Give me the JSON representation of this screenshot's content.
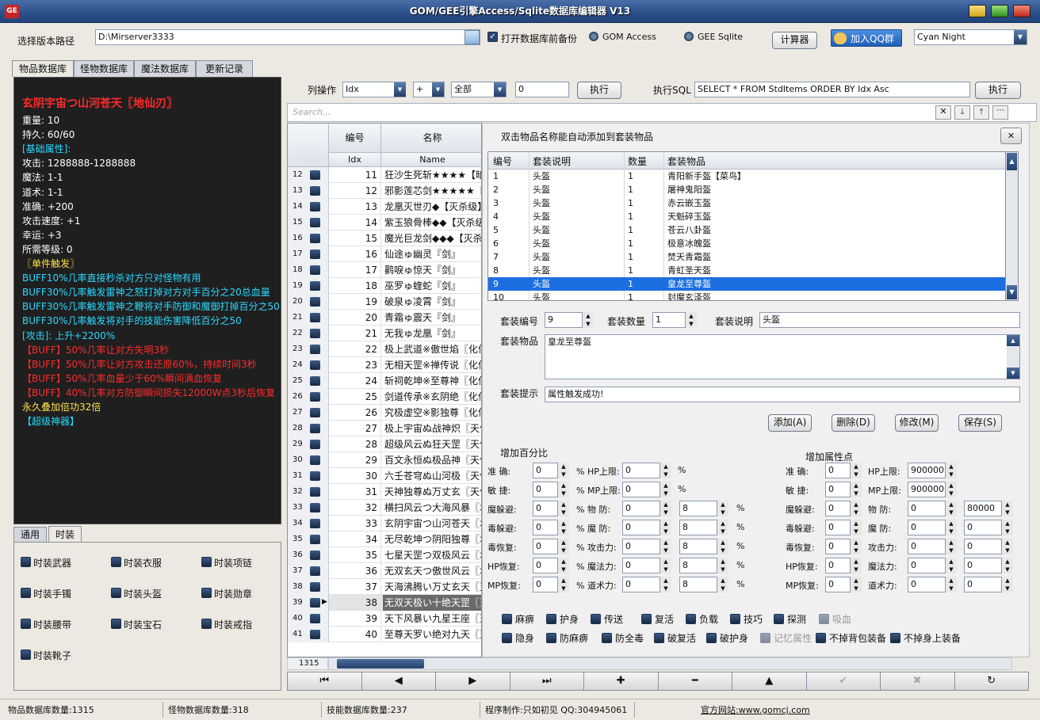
{
  "window": {
    "title": "GOM/GEE引擎Access/Sqlite数据库编辑器 V13",
    "icon_text": "GE"
  },
  "toolbar": {
    "path_label": "选择版本路径",
    "path_value": "D:\\Mirserver3333",
    "backup_label": "打开数据库前备份",
    "gom_label": "GOM Access",
    "gee_label": "GEE Sqlite",
    "calc_label": "计算器",
    "qq_label": "加入QQ群",
    "theme_value": "Cyan Night"
  },
  "tabs": [
    "物品数据库",
    "怪物数据库",
    "魔法数据库",
    "更新记录"
  ],
  "item_info": [
    {
      "t": "玄阴宇宙つ山河苍天〖地仙刃〗",
      "c": "#ff2a2a",
      "b": true
    },
    {
      "t": "重量: 10",
      "c": "#ffffff"
    },
    {
      "t": "持久: 60/60",
      "c": "#ffffff"
    },
    {
      "t": "[基础属性]:",
      "c": "#29d9ff"
    },
    {
      "t": "攻击:        1288888-1288888",
      "c": "#ffffff"
    },
    {
      "t": "魔法:        1-1",
      "c": "#ffffff"
    },
    {
      "t": "道术:        1-1",
      "c": "#ffffff"
    },
    {
      "t": "准确:        +200",
      "c": "#ffffff"
    },
    {
      "t": "攻击速度:    +1",
      "c": "#ffffff"
    },
    {
      "t": "幸运:        +3",
      "c": "#ffffff"
    },
    {
      "t": "所需等级: 0",
      "c": "#ffffff"
    },
    {
      "t": "〖单件触发〗",
      "c": "#ffe34a"
    },
    {
      "t": "BUFF10%几率直接秒杀对方只对怪物有用",
      "c": "#29d9ff"
    },
    {
      "t": "BUFF30%几率触发雷神之怒打掉对方对手百分之20总血量",
      "c": "#29d9ff"
    },
    {
      "t": "BUFF30%几率触发雷神之鞭将对手防御和魔御打掉百分之50",
      "c": "#29d9ff"
    },
    {
      "t": "BUFF30%几率触发将对手的技能伤害降低百分之50",
      "c": "#29d9ff"
    },
    {
      "t": "[攻击]: 上升+2200%",
      "c": "#29d9ff"
    },
    {
      "t": "【BUFF】50%几率让对方失明3秒",
      "c": "#ff2a2a"
    },
    {
      "t": "【BUFF】50%几率让对方攻击还原60%，持续时间3秒",
      "c": "#ff2a2a"
    },
    {
      "t": "【BUFF】50%几率血量少于60%瞬间满血恢复",
      "c": "#ff2a2a"
    },
    {
      "t": "【BUFF】40%几率对方防御瞬间损失12000W点3秒后恢复",
      "c": "#ff2a2a"
    },
    {
      "t": "永久叠加倍功32倍",
      "c": "#ffe34a"
    },
    {
      "t": "【超级神器】",
      "c": "#29d9ff"
    }
  ],
  "lower_tabs": [
    "通用",
    "时装"
  ],
  "fashion": [
    "时装武器",
    "时装衣服",
    "时装项链",
    "时装手镯",
    "时装头盔",
    "时装勋章",
    "时装腰带",
    "时装宝石",
    "时装戒指",
    "时装靴子"
  ],
  "ops": {
    "label": "列操作",
    "col": "Idx",
    "op": "+",
    "scope": "全部",
    "val": "0",
    "exec": "执行",
    "sql_label": "执行SQL",
    "sql": "SELECT * FROM StdItems ORDER BY Idx Asc",
    "exec2": "执行",
    "search_placeholder": "Search..."
  },
  "grid": {
    "col1": "编号",
    "col1b": "Idx",
    "col2": "名称",
    "col2b": "Name",
    "total": "1315",
    "rows": [
      [
        "12",
        "11",
        "狂沙生死斩★★★★【暗"
      ],
      [
        "13",
        "12",
        "邪影莲芯剑★★★★★【暗"
      ],
      [
        "14",
        "13",
        "龙凰灭世刃◆【灭杀级】"
      ],
      [
        "15",
        "14",
        "紫玉狼骨棒◆◆【灭杀级"
      ],
      [
        "16",
        "15",
        "魔光巨龙剑◆◆◆【灭杀"
      ],
      [
        "17",
        "16",
        "仙途ゅ幽灵『剑』"
      ],
      [
        "18",
        "17",
        "鹳唳ゅ惊天『剑』"
      ],
      [
        "19",
        "18",
        "巫罗ゅ蝰蛇『剑』"
      ],
      [
        "20",
        "19",
        "破泉ゅ凌霄『剑』"
      ],
      [
        "21",
        "20",
        "青霜ゅ震天『剑』"
      ],
      [
        "22",
        "21",
        "无我ゅ龙凰『剑』"
      ],
      [
        "23",
        "22",
        "极上武道※傲世焰〖化仙"
      ],
      [
        "24",
        "23",
        "无相天罡※禅传说〖化仙"
      ],
      [
        "25",
        "24",
        "斩祠乾坤※至尊神〖化仙"
      ],
      [
        "26",
        "25",
        "剑道传承※玄阴绝〖化仙"
      ],
      [
        "27",
        "26",
        "究极虚空※影独尊〖化仙"
      ],
      [
        "28",
        "27",
        "极上宇宙ぬ战神炽〖天仙"
      ],
      [
        "29",
        "28",
        "超级风云ぬ狂天罡〖天仙"
      ],
      [
        "30",
        "29",
        "百文永恒ぬ极品神〖天仙"
      ],
      [
        "31",
        "30",
        "六壬苍穹ぬ山河极〖天仙"
      ],
      [
        "32",
        "31",
        "天神独尊ぬ万丈玄〖天仙"
      ],
      [
        "33",
        "32",
        "横扫风云つ大海风暴〖地"
      ],
      [
        "34",
        "33",
        "玄阴宇宙つ山河苍天〖地"
      ],
      [
        "35",
        "34",
        "无尽乾坤つ阴阳独尊〖地"
      ],
      [
        "36",
        "35",
        "七星天罡つ双极风云〖地"
      ],
      [
        "37",
        "36",
        "无双玄天つ傲世风云〖地"
      ],
      [
        "38",
        "37",
        "天海沸腾い万丈玄天〖至"
      ],
      [
        "39",
        "38",
        "无双天极い十绝天罡〖至"
      ],
      [
        "40",
        "39",
        "天下风暴い九星王座〖至"
      ],
      [
        "41",
        "40",
        "至尊天罗い绝对九天〖至"
      ]
    ]
  },
  "suit": {
    "title": "双击物品名称能自动添加到套装物品",
    "headers": [
      "编号",
      "套装说明",
      "数量",
      "套装物品"
    ],
    "rows": [
      [
        "1",
        "头盔",
        "1",
        "青阳新手盔【菜鸟】"
      ],
      [
        "2",
        "头盔",
        "1",
        "屠神鬼阳盔"
      ],
      [
        "3",
        "头盔",
        "1",
        "赤云嵌玉盔"
      ],
      [
        "4",
        "头盔",
        "1",
        "天魁碎玉盔"
      ],
      [
        "5",
        "头盔",
        "1",
        "苍云八卦盔"
      ],
      [
        "6",
        "头盔",
        "1",
        "极意冰魄盔"
      ],
      [
        "7",
        "头盔",
        "1",
        "焚天青霜盔"
      ],
      [
        "8",
        "头盔",
        "1",
        "青虹圣天盔"
      ],
      [
        "9",
        "头盔",
        "1",
        "皇龙至尊盔"
      ],
      [
        "10",
        "头盔",
        "1",
        "封魔玄泽盔"
      ]
    ],
    "selected": 8,
    "f_no_label": "套装编号",
    "f_no": "9",
    "f_qty_label": "套装数量",
    "f_qty": "1",
    "f_desc_label": "套装说明",
    "f_desc": "头盔",
    "f_items_label": "套装物品",
    "f_items": "皇龙至尊盔",
    "f_tip_label": "套装提示",
    "f_tip": "属性触发成功!",
    "btn_add": "添加(A)",
    "btn_del": "删除(D)",
    "btn_mod": "修改(M)",
    "btn_save": "保存(S)",
    "pct_title": "增加百分比",
    "attr_title": "增加属性点",
    "pct_rows": [
      [
        "准 确:",
        "0",
        "% HP上限:",
        "0",
        "%",
        ""
      ],
      [
        "敏 捷:",
        "0",
        "% MP上限:",
        "0",
        "%",
        ""
      ],
      [
        "魔躲避:",
        "0",
        "% 物 防:",
        "0",
        "8",
        "%"
      ],
      [
        "毒躲避:",
        "0",
        "% 魔 防:",
        "0",
        "8",
        "%"
      ],
      [
        "毒恢复:",
        "0",
        "% 攻击力:",
        "0",
        "8",
        "%"
      ],
      [
        "HP恢复:",
        "0",
        "% 魔法力:",
        "0",
        "8",
        "%"
      ],
      [
        "MP恢复:",
        "0",
        "% 道术力:",
        "0",
        "8",
        "%"
      ]
    ],
    "attr_rows": [
      [
        "准 确:",
        "0",
        "HP上限:",
        "900000",
        ""
      ],
      [
        "敏 捷:",
        "0",
        "MP上限:",
        "900000",
        ""
      ],
      [
        "魔躲避:",
        "0",
        "物 防:",
        "0",
        "80000"
      ],
      [
        "毒躲避:",
        "0",
        "魔 防:",
        "0",
        "0"
      ],
      [
        "毒恢复:",
        "0",
        "攻击力:",
        "0",
        "0"
      ],
      [
        "HP恢复:",
        "0",
        "魔法力:",
        "0",
        "0"
      ],
      [
        "MP恢复:",
        "0",
        "道术力:",
        "0",
        "0"
      ]
    ],
    "flags1": [
      "麻痹",
      "护身",
      "传送",
      "复活",
      "负载",
      "技巧",
      "探测",
      "吸血"
    ],
    "flags2": [
      "隐身",
      "防麻痹",
      "防全毒",
      "破复活",
      "破护身",
      "记忆属性",
      "不掉背包装备",
      "不掉身上装备"
    ]
  },
  "status": {
    "items": "物品数据库数量:1315",
    "monsters": "怪物数据库数量:318",
    "skills": "技能数据库数量:237",
    "author": "程序制作:只如初见 QQ:304945061",
    "site": "官方网站:www.gomcj.com"
  }
}
